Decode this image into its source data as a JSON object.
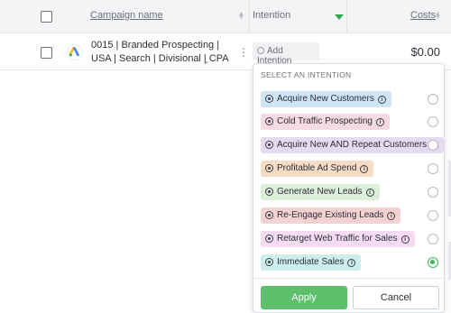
{
  "header": {
    "campaign_label": "Campaign name",
    "intention_label": "Intention",
    "costs_label": "Costs"
  },
  "row": {
    "campaign_name": "0015 | Branded Prospecting | USA | Search | Divisional | CPA",
    "add_intention": "Add Intention",
    "cost": "$0.00"
  },
  "dropdown": {
    "heading": "SELECT AN INTENTION",
    "options": [
      {
        "label": "Acquire New Customers",
        "color": "#cfe4f7",
        "selected": false
      },
      {
        "label": "Cold Traffic Prospecting",
        "color": "#f7d9e3",
        "selected": false
      },
      {
        "label": "Acquire New AND Repeat Customers",
        "color": "#e6daf0",
        "selected": false
      },
      {
        "label": "Profitable Ad Spend",
        "color": "#f7dcc5",
        "selected": false
      },
      {
        "label": "Generate New Leads",
        "color": "#dcefd9",
        "selected": false
      },
      {
        "label": "Re-Engage Existing Leads",
        "color": "#f4d2d2",
        "selected": false
      },
      {
        "label": "Retarget Web Traffic for Sales",
        "color": "#f5dcf3",
        "selected": false
      },
      {
        "label": "Immediate Sales",
        "color": "#cdeeed",
        "selected": true
      }
    ],
    "apply_label": "Apply",
    "cancel_label": "Cancel"
  },
  "icons": {
    "sort": "sort-icon",
    "filter": "filter-icon",
    "google_ads": "google-ads-icon",
    "chevron": "chevron-down-icon",
    "kebab": "kebab-menu-icon",
    "target": "target-icon",
    "info": "info-icon"
  },
  "colors": {
    "accent_green": "#5bbf6b",
    "radio_selected": "#3cba5a"
  }
}
